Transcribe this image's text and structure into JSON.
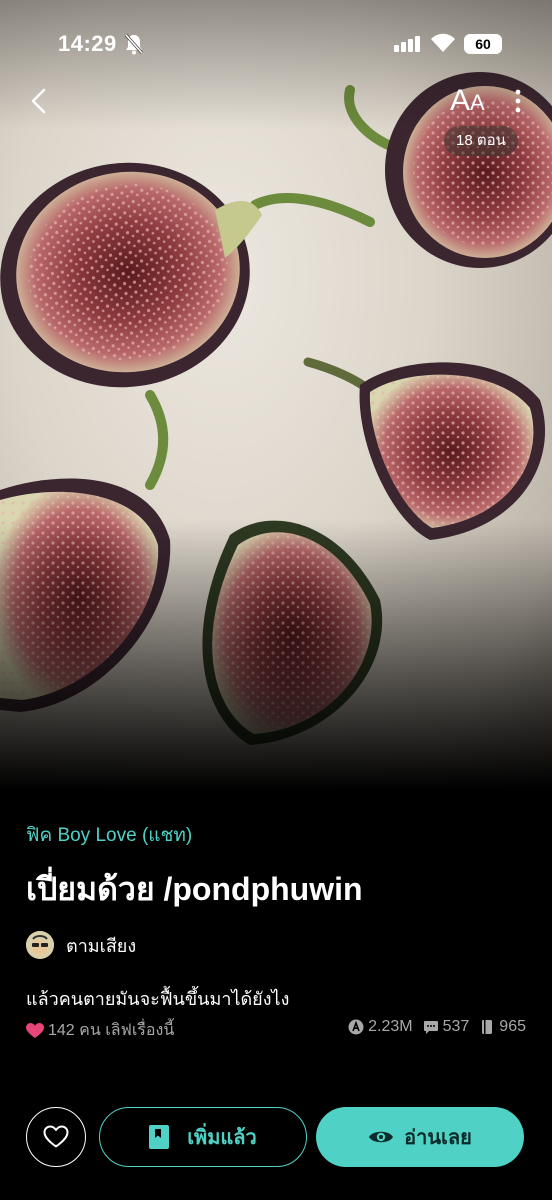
{
  "status_bar": {
    "time": "14:29",
    "battery": "60"
  },
  "header": {
    "font_size_label": "A",
    "font_size_label_small": "A",
    "episodes": "18 ตอน"
  },
  "story": {
    "genre": "ฟิค Boy Love (แชท)",
    "title": "เปี่ยมด้วย /pondphuwin",
    "author": "ตามเสียง",
    "synopsis": "แล้วคนตายมันจะฟื้นขึ้นมาได้ยังไง",
    "likes_text": "142 คน เลิฟเรื่องนี้",
    "views": "2.23M",
    "comments": "537",
    "episodes_count": "965"
  },
  "actions": {
    "added_label": "เพิ่มแล้ว",
    "read_label": "อ่านเลย"
  },
  "colors": {
    "accent": "#4fd1c5",
    "like": "#e8457a",
    "background": "#000000"
  },
  "icons": {
    "back": "chevron-left-icon",
    "more": "more-vertical-icon",
    "favorite": "heart-outline-icon",
    "library": "bookmark-icon",
    "read": "eye-icon"
  }
}
